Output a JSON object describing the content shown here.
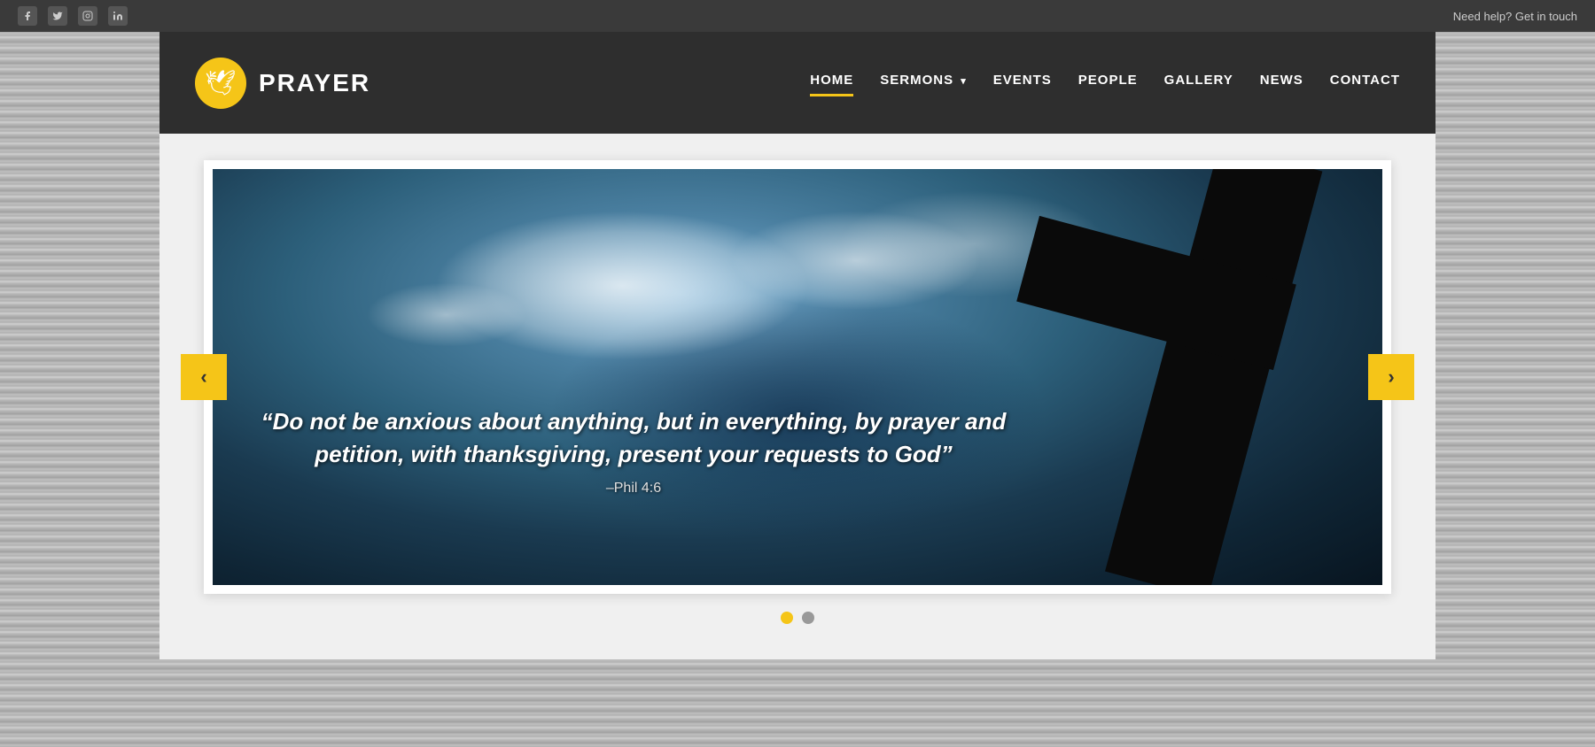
{
  "topbar": {
    "help_text": "Need help? Get in touch",
    "social": [
      {
        "name": "facebook",
        "icon": "f"
      },
      {
        "name": "twitter",
        "icon": "t"
      },
      {
        "name": "instagram",
        "icon": "i"
      },
      {
        "name": "linkedin",
        "icon": "in"
      }
    ]
  },
  "header": {
    "logo_text": "PRAYER",
    "nav_items": [
      {
        "label": "HOME",
        "active": true,
        "has_dropdown": false
      },
      {
        "label": "SERMONS",
        "active": false,
        "has_dropdown": true
      },
      {
        "label": "EVENTS",
        "active": false,
        "has_dropdown": false
      },
      {
        "label": "PEOPLE",
        "active": false,
        "has_dropdown": false
      },
      {
        "label": "GALLERY",
        "active": false,
        "has_dropdown": false
      },
      {
        "label": "NEWS",
        "active": false,
        "has_dropdown": false
      },
      {
        "label": "CONTACT",
        "active": false,
        "has_dropdown": false
      }
    ]
  },
  "slider": {
    "quote": "“Do not be anxious about anything, but in everything, by prayer and petition, with thanksgiving, present your requests to God”",
    "reference": "–Phil 4:6",
    "prev_label": "‹",
    "next_label": "›",
    "dots": [
      {
        "active": true
      },
      {
        "active": false
      }
    ]
  }
}
